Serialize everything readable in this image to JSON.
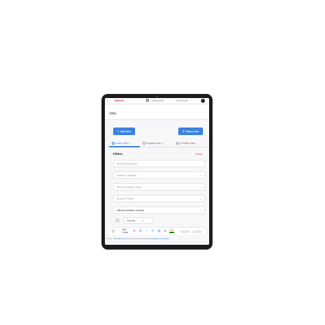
{
  "topbar": {
    "menu_icon": "menu-icon",
    "logo_text": "IDEAXS",
    "lang_text": "LANGUAGE",
    "user_text": "NICHOLAS"
  },
  "page": {
    "title": "Jobs"
  },
  "actions": {
    "add_job": "Add Job",
    "share_job": "Share Job"
  },
  "tabs": [
    {
      "label": "Active Jobs",
      "badge": "1",
      "active": true
    },
    {
      "label": "Expired Jobs",
      "badge": "0",
      "active": false
    },
    {
      "label": "In Active Jobs",
      "badge": "",
      "active": false
    }
  ],
  "filters": {
    "title": "Filters",
    "reset": "Reset",
    "search_keywords": "Search Keywords",
    "search_company": "Search Company",
    "search_industry": "Search Industry Type",
    "search_priority": "Search Priority",
    "deleted_records": "Without deleted records"
  },
  "sort": {
    "label": "Sort by",
    "caret": "▾"
  },
  "list": {
    "job_code_label": "Job Code",
    "icons": [
      "heart-icon",
      "gear-icon",
      "gender-icon",
      "search-icon",
      "chart-icon",
      "tag-icon"
    ],
    "flag_colors": [
      "#ff9933",
      "#ffffff",
      "#138808"
    ]
  },
  "footer": {
    "copyright": "© 2012 - 2024",
    "version": "FMPP_AM",
    "rights": "All rights reserved. Developed by",
    "poweredby": "Quantiva Technologies"
  },
  "colors": {
    "accent": "#3c82dc",
    "reset": "#e0412f",
    "logo": "#d8283a"
  }
}
